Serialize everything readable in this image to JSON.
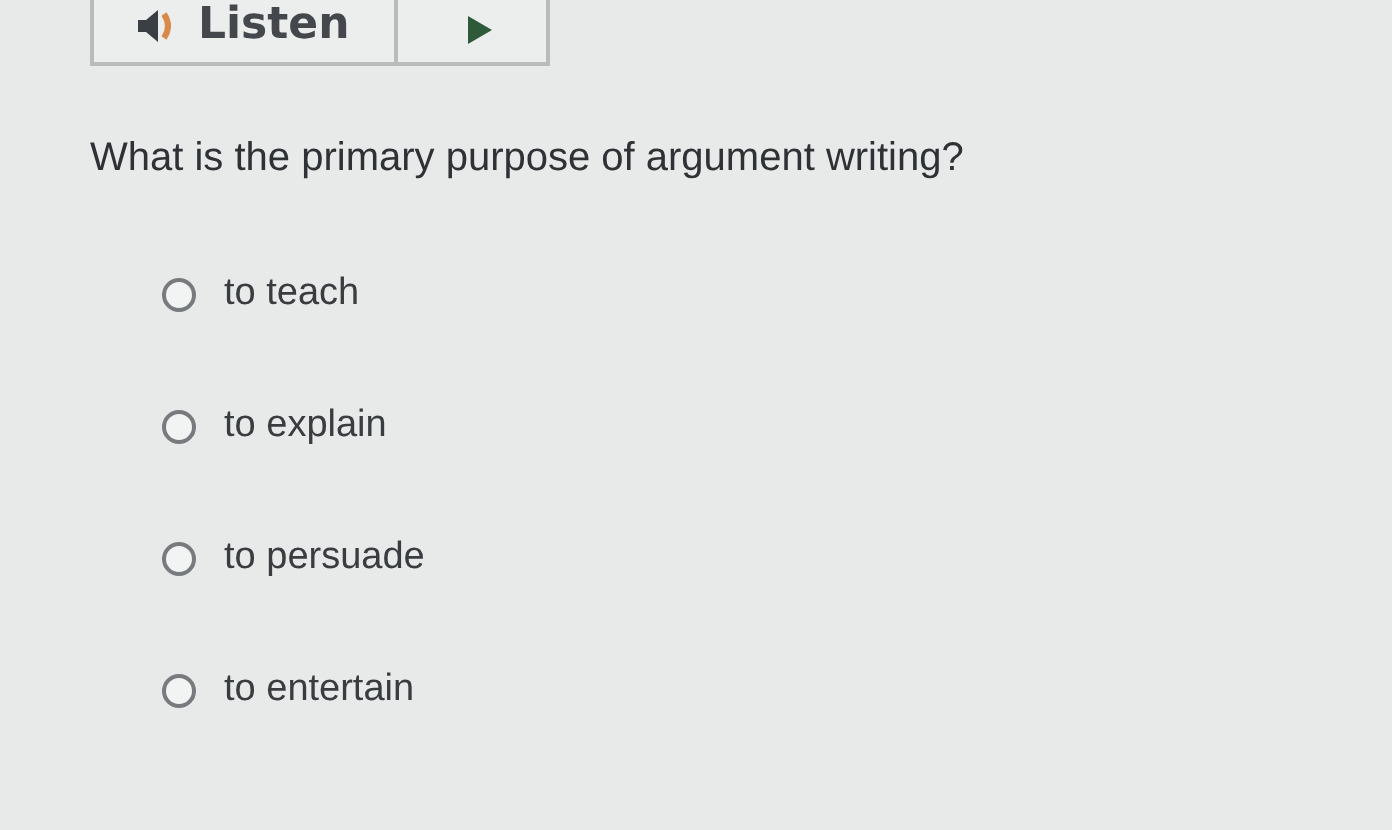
{
  "listen": {
    "label": "Listen"
  },
  "question": "What is the primary purpose of argument writing?",
  "options": [
    {
      "label": "to teach",
      "selected": false
    },
    {
      "label": "to explain",
      "selected": false
    },
    {
      "label": "to persuade",
      "selected": false
    },
    {
      "label": "to entertain",
      "selected": false
    }
  ]
}
